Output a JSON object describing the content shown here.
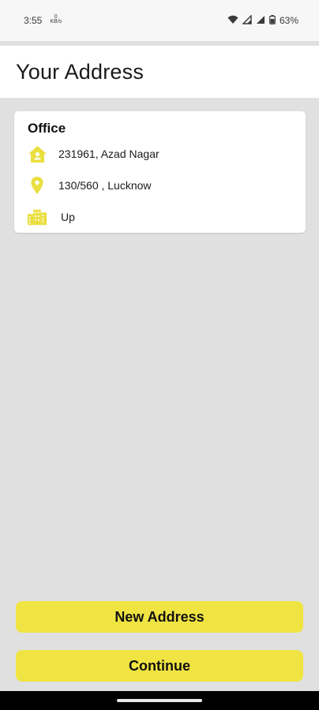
{
  "status_bar": {
    "time": "3:55",
    "data_speed_value": "0",
    "data_speed_unit": "KB/s",
    "battery": "63%",
    "icons": [
      "wifi-icon",
      "signal-icon",
      "battery-icon"
    ]
  },
  "header": {
    "title": "Your Address"
  },
  "address_card": {
    "title": "Office",
    "rows": [
      {
        "icon": "home-icon",
        "text": "231961, Azad Nagar"
      },
      {
        "icon": "location-pin-icon",
        "text": "130/560 , Lucknow"
      },
      {
        "icon": "city-icon",
        "text": "Up"
      }
    ]
  },
  "buttons": {
    "new_address": "New Address",
    "continue": "Continue"
  },
  "colors": {
    "accent": "#f0e442",
    "background": "#e0e0e0",
    "card": "#ffffff"
  }
}
